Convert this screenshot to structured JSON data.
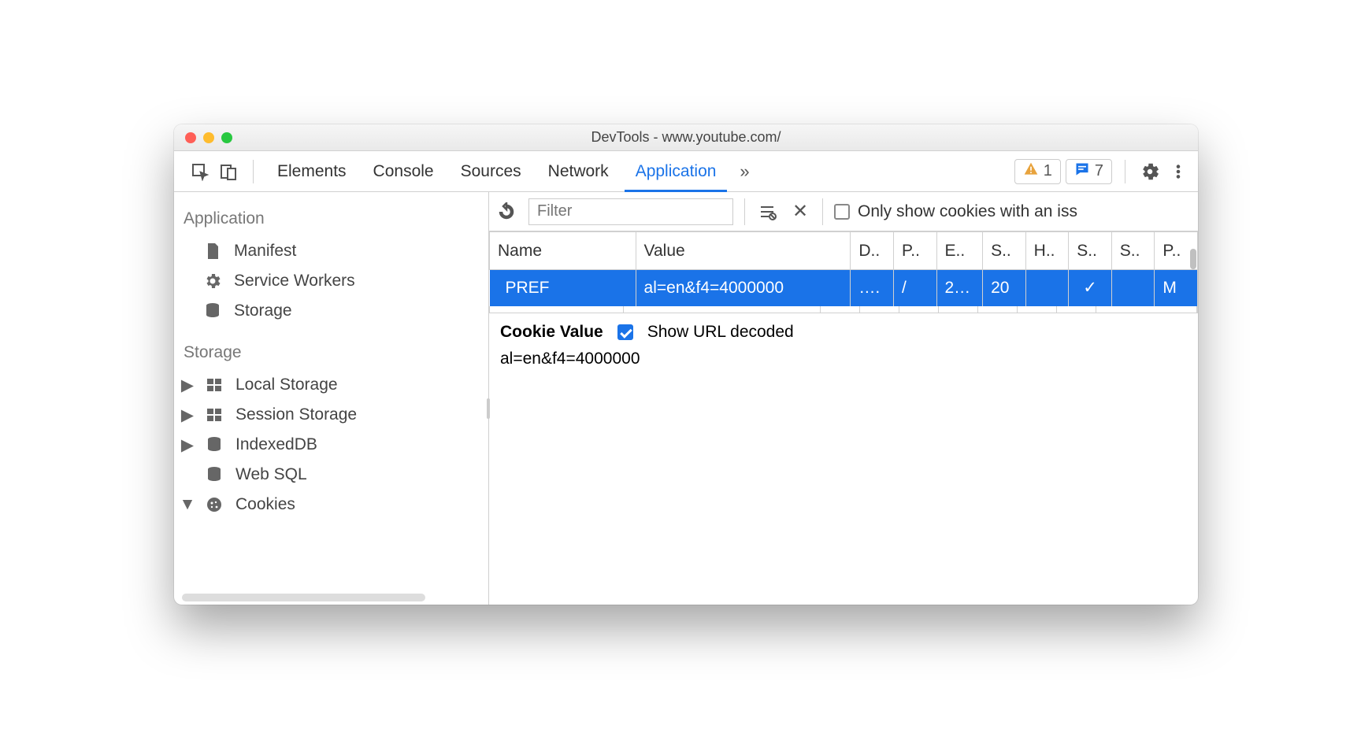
{
  "window": {
    "title": "DevTools - www.youtube.com/"
  },
  "toolbar": {
    "tabs": [
      "Elements",
      "Console",
      "Sources",
      "Network",
      "Application"
    ],
    "active": "Application",
    "warnings": "1",
    "messages": "7"
  },
  "sidebar": {
    "section1_title": "Application",
    "section1": [
      {
        "icon": "file",
        "label": "Manifest"
      },
      {
        "icon": "gear",
        "label": "Service Workers"
      },
      {
        "icon": "db",
        "label": "Storage"
      }
    ],
    "section2_title": "Storage",
    "section2": [
      {
        "icon": "grid",
        "label": "Local Storage",
        "arrow": "right"
      },
      {
        "icon": "grid",
        "label": "Session Storage",
        "arrow": "right"
      },
      {
        "icon": "db",
        "label": "IndexedDB",
        "arrow": "right"
      },
      {
        "icon": "db",
        "label": "Web SQL",
        "arrow": "none"
      },
      {
        "icon": "cookie",
        "label": "Cookies",
        "arrow": "down"
      }
    ]
  },
  "main": {
    "filter_placeholder": "Filter",
    "issue_label": "Only show cookies with an iss",
    "columns": [
      "Name",
      "Value",
      "D..",
      "P..",
      "E..",
      "S..",
      "H..",
      "S..",
      "S..",
      "P.."
    ],
    "row": {
      "name": "PREF",
      "value": "al=en&f4=4000000",
      "domain": "….",
      "path": "/",
      "expires": "2…",
      "size": "20",
      "httponly": "",
      "secure": "✓",
      "samesite": "",
      "priority": "M"
    },
    "detail_title": "Cookie Value",
    "decoded_label": "Show URL decoded",
    "decoded_value": "al=en&f4=4000000"
  }
}
